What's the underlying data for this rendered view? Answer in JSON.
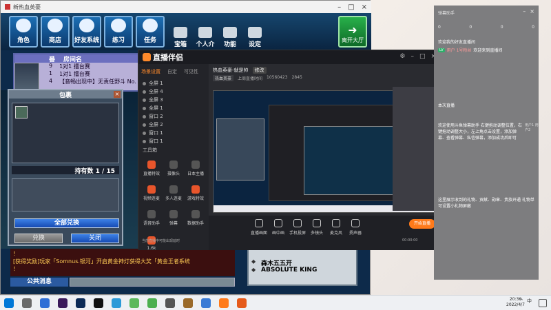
{
  "game": {
    "window_title": "新热血英豪",
    "nav_buttons": [
      "角色",
      "商店",
      "好友系统",
      "练习",
      "任务"
    ],
    "nav_plain": [
      "宝箱",
      "个人介绍",
      "功能",
      "设定"
    ],
    "exit_label": "离开大厅",
    "room_headers": [
      "番",
      "房间名"
    ],
    "rooms": [
      {
        "no": "9",
        "name": "1对1 擂台赛"
      },
      {
        "no": "1",
        "name": "1对1 擂台赛"
      },
      {
        "no": "4",
        "name": "【音畅出现中】无责任野斗 No."
      }
    ],
    "item_dialog": {
      "title": "包裹",
      "count_label": "持有数 1 / 15",
      "exchange_all": "全部兑换",
      "exchange": "兑换",
      "close": "关闭",
      "close_icon": "×"
    },
    "chat_lines": [
      "！",
      "[获得奖励]玩家「Somnus.银河」开启黄金神灯获得大奖「黄金王者系统",
      "！"
    ],
    "public_msg": "公共消息",
    "players": [
      "ABSOLUTE KING",
      "森木五五开"
    ]
  },
  "stream": {
    "app_name": "直播伴侣",
    "tabs": [
      "场景设置",
      "自定",
      "可见性"
    ],
    "scenes": [
      "全屏 1",
      "全屏 4",
      "全屏 3",
      "全屏 1",
      "窗口 2",
      "全屏 2",
      "窗口 1",
      "窗口 1"
    ],
    "tools_label": "工具箱",
    "tools": [
      "直播特效",
      "摄像头",
      "日本主播",
      "视频连麦",
      "多人连麦",
      "游戏特效",
      "语音助手",
      "弹幕",
      "数据助手",
      "1.6k"
    ],
    "title": "热血英豪-就是帅",
    "edit_badge": "修改",
    "meta": [
      "热血英豪",
      "上周直播时间",
      "10560423",
      "2845"
    ],
    "bottom_buttons": [
      "直播画面",
      "画中画",
      "手机投屏",
      "多镜头",
      "麦克风",
      "扬声器"
    ],
    "start_live": "开始直播",
    "status_text": "当前直播中可能出现延时",
    "time_text": "00:00:00"
  },
  "assistant": {
    "title": "弹幕助手",
    "stats": [
      "0",
      "0",
      "0",
      "0"
    ],
    "msg1": "欢迎我的好友直播间",
    "msg2_badge": "LV",
    "msg2_name": "用户 1号粉丝",
    "msg2_text": "欢迎来到直播间",
    "msg3": "本次直播",
    "block1": "欢迎使用斗鱼弹幕助手 右键拖动调整位置，右键拖动调整大小，左上角点击设置，添加弹幕、查看弹幕、私信弹幕，添加成功后即可",
    "side_text": "用户1 用户2",
    "block2": "这里展示收到的礼物、贡献、勋章、贵族开通 礼物单可设置小礼物屏蔽"
  },
  "taskbar": {
    "time": "20:36",
    "date": "2022/4/7",
    "tray": [
      "^",
      "中"
    ]
  }
}
